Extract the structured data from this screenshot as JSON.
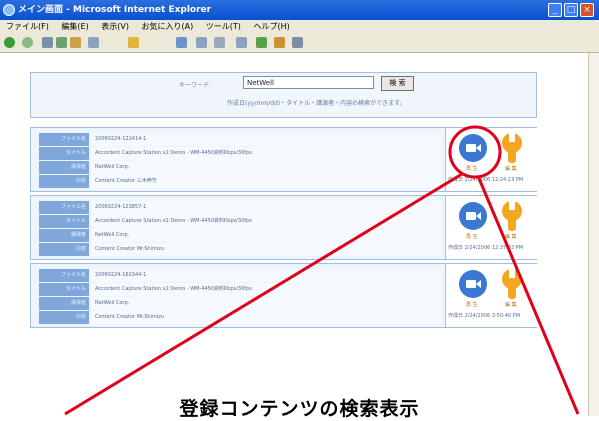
{
  "window": {
    "title": "メイン画面 - Microsoft Internet Explorer",
    "menu": [
      "ファイル(F)",
      "編集(E)",
      "表示(V)",
      "お気に入り(A)",
      "ツール(T)",
      "ヘルプ(H)"
    ]
  },
  "search": {
    "label": "キーワード:",
    "value": "NetWell",
    "button": "検 索",
    "note": "作成日(yy/mm/dd)・タイトル・講演者・内容の検索ができます。"
  },
  "field_labels": [
    "ファイル名",
    "タイトル",
    "講演者",
    "内容"
  ],
  "results": [
    {
      "id": "20060224-122414-1",
      "title": "Accordent Capture Station v2 Demo - WM-4450資料Kbps/30fps",
      "speaker": "NetWell Corp.",
      "content": "Content Creator 三木伸竹",
      "play_label": "再 生",
      "edit_label": "編 集",
      "created": "作成日 2/24/2006 12:24:23 PM"
    },
    {
      "id": "20060224-123857-1",
      "title": "Accordent Capture Station v2 Demo - WM-4450資料Kbps/30fps",
      "speaker": "NetWell Corp.",
      "content": "Content Creator  Mr.Shimizu",
      "play_label": "再 生",
      "edit_label": "編 集",
      "created": "作成日 2/24/2006 12:37:02 PM"
    },
    {
      "id": "20060224-160344-1",
      "title": "Accordent Capture Station v2 Demo - WM-4450資料Kbps/30fps",
      "speaker": "NetWell Corp.",
      "content": "Content Creator  Mr.Shimizu",
      "play_label": "再 生",
      "edit_label": "編 集",
      "created": "作成日 2/24/2006 3:50:40 PM"
    }
  ],
  "caption": "登録コンテンツの検索表示",
  "colors": {
    "titlebar": "#0a4fcf",
    "field_label_bg": "#7fa7dc",
    "annotation_red": "#e0001a",
    "play_icon": "#3b78d2",
    "edit_icon": "#f3a61f"
  }
}
